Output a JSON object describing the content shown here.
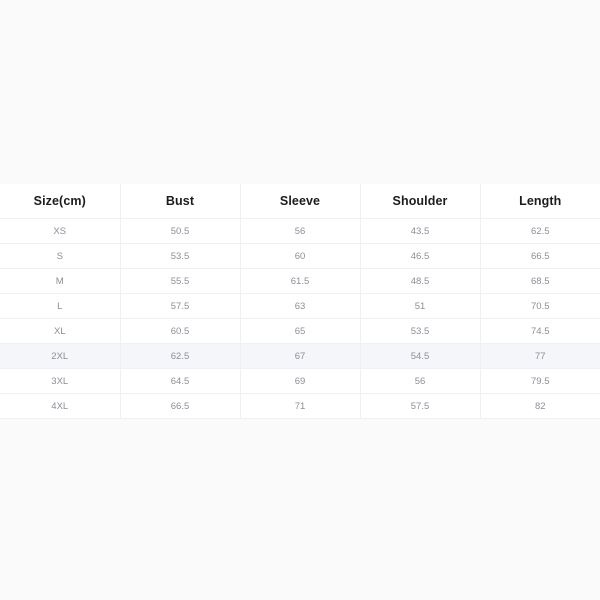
{
  "background_color": "#fafafa",
  "table": {
    "name": "garment-size-chart",
    "highlighted_row_index": 5,
    "highlight_color": "#f4f6fa",
    "header_text_color": "#1c1c1c",
    "cell_text_color": "#8a8f98",
    "border_color": "#f0f1f3",
    "columns": [
      "Size(cm)",
      "Bust",
      "Sleeve",
      "Shoulder",
      "Length"
    ],
    "rows": [
      {
        "size": "XS",
        "bust": "50.5",
        "sleeve": "56",
        "shoulder": "43.5",
        "length": "62.5"
      },
      {
        "size": "S",
        "bust": "53.5",
        "sleeve": "60",
        "shoulder": "46.5",
        "length": "66.5"
      },
      {
        "size": "M",
        "bust": "55.5",
        "sleeve": "61.5",
        "shoulder": "48.5",
        "length": "68.5"
      },
      {
        "size": "L",
        "bust": "57.5",
        "sleeve": "63",
        "shoulder": "51",
        "length": "70.5"
      },
      {
        "size": "XL",
        "bust": "60.5",
        "sleeve": "65",
        "shoulder": "53.5",
        "length": "74.5"
      },
      {
        "size": "2XL",
        "bust": "62.5",
        "sleeve": "67",
        "shoulder": "54.5",
        "length": "77"
      },
      {
        "size": "3XL",
        "bust": "64.5",
        "sleeve": "69",
        "shoulder": "56",
        "length": "79.5"
      },
      {
        "size": "4XL",
        "bust": "66.5",
        "sleeve": "71",
        "shoulder": "57.5",
        "length": "82"
      }
    ]
  }
}
